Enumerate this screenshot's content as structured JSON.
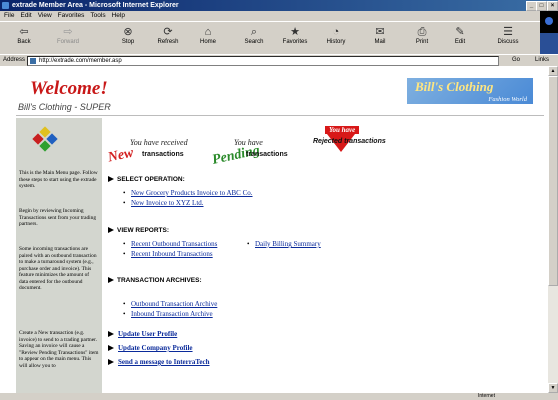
{
  "window": {
    "title": "extrade Member Area - Microsoft Internet Explorer",
    "minimize": "_",
    "maximize": "□",
    "close": "×"
  },
  "menu": [
    "File",
    "Edit",
    "View",
    "Favorites",
    "Tools",
    "Help"
  ],
  "toolbar": [
    {
      "label": "Back",
      "icon": "back-arrow-icon",
      "glyph": "⇦"
    },
    {
      "label": "Forward",
      "icon": "forward-arrow-icon",
      "glyph": "⇨"
    },
    {
      "label": "Stop",
      "icon": "stop-icon",
      "glyph": "⊗"
    },
    {
      "label": "Refresh",
      "icon": "refresh-icon",
      "glyph": "⟳"
    },
    {
      "label": "Home",
      "icon": "home-icon",
      "glyph": "⌂"
    },
    {
      "label": "Search",
      "icon": "search-icon",
      "glyph": "⌕"
    },
    {
      "label": "Favorites",
      "icon": "favorites-icon",
      "glyph": "★"
    },
    {
      "label": "History",
      "icon": "history-icon",
      "glyph": "◔"
    },
    {
      "label": "Mail",
      "icon": "mail-icon",
      "glyph": "✉"
    },
    {
      "label": "Print",
      "icon": "print-icon",
      "glyph": "⎙"
    },
    {
      "label": "Edit",
      "icon": "edit-icon",
      "glyph": "✎"
    },
    {
      "label": "Discuss",
      "icon": "discuss-icon",
      "glyph": "☰"
    }
  ],
  "address": {
    "label": "Address",
    "url": "http://extrade.com/member.asp",
    "go": "Go",
    "links": "Links"
  },
  "page": {
    "welcome": "Welcome!",
    "subtitle": "Bill's Clothing - SUPER",
    "logo_main": "Bill's Clothing",
    "logo_sub": "Fashion World"
  },
  "sidebar": {
    "p1": "This is the Main Menu page.  Follow these steps to start using the extrade system.",
    "p2": "Begin by reviewing Incoming Transactions sent from your trading partners.",
    "p3": "Some incoming transactions are paired with an outbound transaction to make a turnaround system (e.g., purchase order and invoice). This feature minimizes the amount of data entered for the outbound document.",
    "p4": "Create a New transaction (e.g. invoice) to send to a trading partner.  Saving an invoice will cause a \"Review Pending Transactions\" item to appear on the main menu. This will allow you to"
  },
  "badges": {
    "received": {
      "big": "New",
      "small": "You have received",
      "text": "transactions"
    },
    "pending": {
      "big": "Pending",
      "small": "You have",
      "text": "transactions"
    },
    "rejected": {
      "big": "You have",
      "text": "Rejected transactions"
    }
  },
  "sections": {
    "select": "SELECT OPERATION:",
    "view": "VIEW REPORTS:",
    "archives": "TRANSACTION ARCHIVES:"
  },
  "links": {
    "grocery": "New Grocery Products Invoice to ABC Co.",
    "xyz": "New Invoice to XYZ Ltd.",
    "outbound": "Recent Outbound Transactions",
    "inbound": "Recent Inbound Transactions",
    "billing": "Daily Billing Summary",
    "out_archive": "Outbound Transaction Archive",
    "in_archive": "Inbound Transaction Archive",
    "user_profile": "Update User Profile",
    "company_profile": "Update Company Profile",
    "message": "Send a message to InterraTech"
  },
  "status": {
    "zone": "Internet"
  }
}
